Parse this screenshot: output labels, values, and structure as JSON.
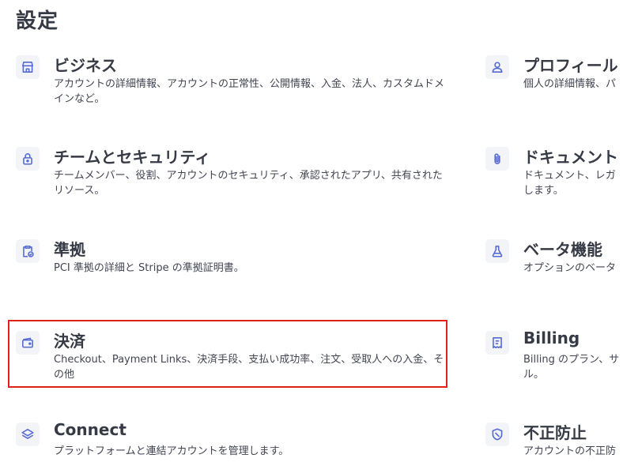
{
  "page": {
    "title": "設定"
  },
  "left_cards": [
    {
      "title": "ビジネス",
      "description": "アカウントの詳細情報、アカウントの正常性、公開情報、入金、法人、カスタムドメインなど。",
      "icon": "storefront-icon"
    },
    {
      "title": "チームとセキュリティ",
      "description": "チームメンバー、役割、アカウントのセキュリティ、承認されたアプリ、共有されたリソース。",
      "icon": "lock-icon"
    },
    {
      "title": "準拠",
      "description": "PCI 準拠の詳細と Stripe の準拠証明書。",
      "icon": "clipboard-check-icon"
    },
    {
      "title": "決済",
      "description": "Checkout、Payment Links、決済手段、支払い成功率、注文、受取人への入金、その他",
      "icon": "wallet-icon"
    },
    {
      "title": "Connect",
      "description": "プラットフォームと連結アカウントを管理します。",
      "icon": "layers-icon"
    }
  ],
  "right_cards": [
    {
      "title": "プロフィール",
      "description": "個人の詳細情報、パ",
      "icon": "person-icon"
    },
    {
      "title": "ドキュメント",
      "description": "ドキュメント、レガ\nします。",
      "icon": "paperclip-icon"
    },
    {
      "title": "ベータ機能",
      "description": "オプションのベータ",
      "icon": "flask-icon"
    },
    {
      "title": "Billing",
      "description": "Billing のプラン、サ\nル。",
      "icon": "invoice-icon"
    },
    {
      "title": "不正防止",
      "description": "アカウントの不正防",
      "icon": "shield-icon"
    }
  ],
  "colors": {
    "icon": "#5469d4",
    "highlight": "#e01f1f",
    "icon_bg": "#f2f4f8"
  }
}
